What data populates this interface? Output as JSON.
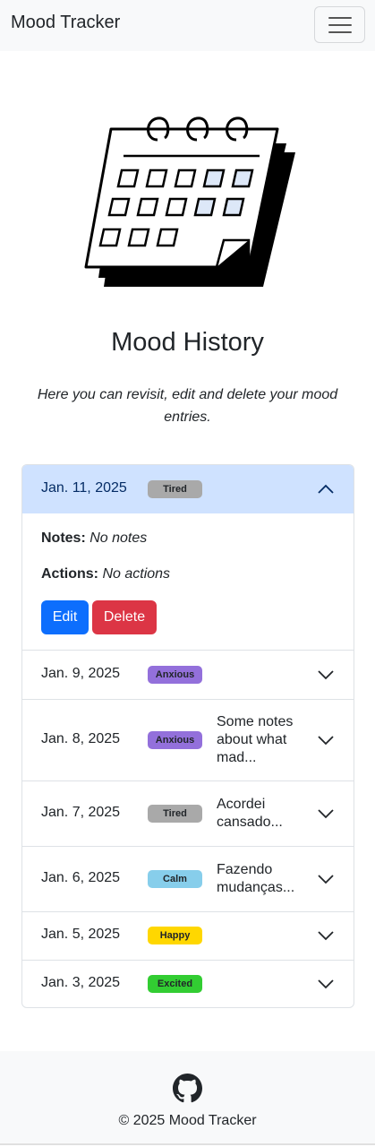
{
  "navbar": {
    "brand": "Mood Tracker",
    "toggle_icon": "hamburger-icon"
  },
  "hero": {
    "illustration": "calendar-illustration",
    "title": "Mood History",
    "subtitle": "Here you can revisit, edit and delete your mood entries."
  },
  "entries": [
    {
      "date": "Jan. 11, 2025",
      "mood": "Tired",
      "badge_color": "#a9a9a9",
      "badge_text_color": "#212529",
      "expanded": true,
      "notes_label": "Notes:",
      "notes_value": "No notes",
      "actions_label": "Actions:",
      "actions_value": "No actions",
      "edit_label": "Edit",
      "delete_label": "Delete"
    },
    {
      "date": "Jan. 9, 2025",
      "mood": "Anxious",
      "badge_color": "#9370db",
      "badge_text_color": "#212529",
      "note": ""
    },
    {
      "date": "Jan. 8, 2025",
      "mood": "Anxious",
      "badge_color": "#9370db",
      "badge_text_color": "#212529",
      "note": "Some notes about what mad..."
    },
    {
      "date": "Jan. 7, 2025",
      "mood": "Tired",
      "badge_color": "#a9a9a9",
      "badge_text_color": "#212529",
      "note": "Acordei cansado..."
    },
    {
      "date": "Jan. 6, 2025",
      "mood": "Calm",
      "badge_color": "#87ceeb",
      "badge_text_color": "#212529",
      "note": "Fazendo mudanças..."
    },
    {
      "date": "Jan. 5, 2025",
      "mood": "Happy",
      "badge_color": "#ffd700",
      "badge_text_color": "#212529",
      "note": ""
    },
    {
      "date": "Jan. 3, 2025",
      "mood": "Excited",
      "badge_color": "#32cd32",
      "badge_text_color": "#212529",
      "note": ""
    }
  ],
  "footer": {
    "icon": "github-icon",
    "copyright": "© 2025 Mood Tracker"
  },
  "colors": {
    "primary": "#0d6efd",
    "danger": "#dc3545",
    "expanded_header": "#cfe2ff",
    "navbar_bg": "#f8f9fa"
  }
}
